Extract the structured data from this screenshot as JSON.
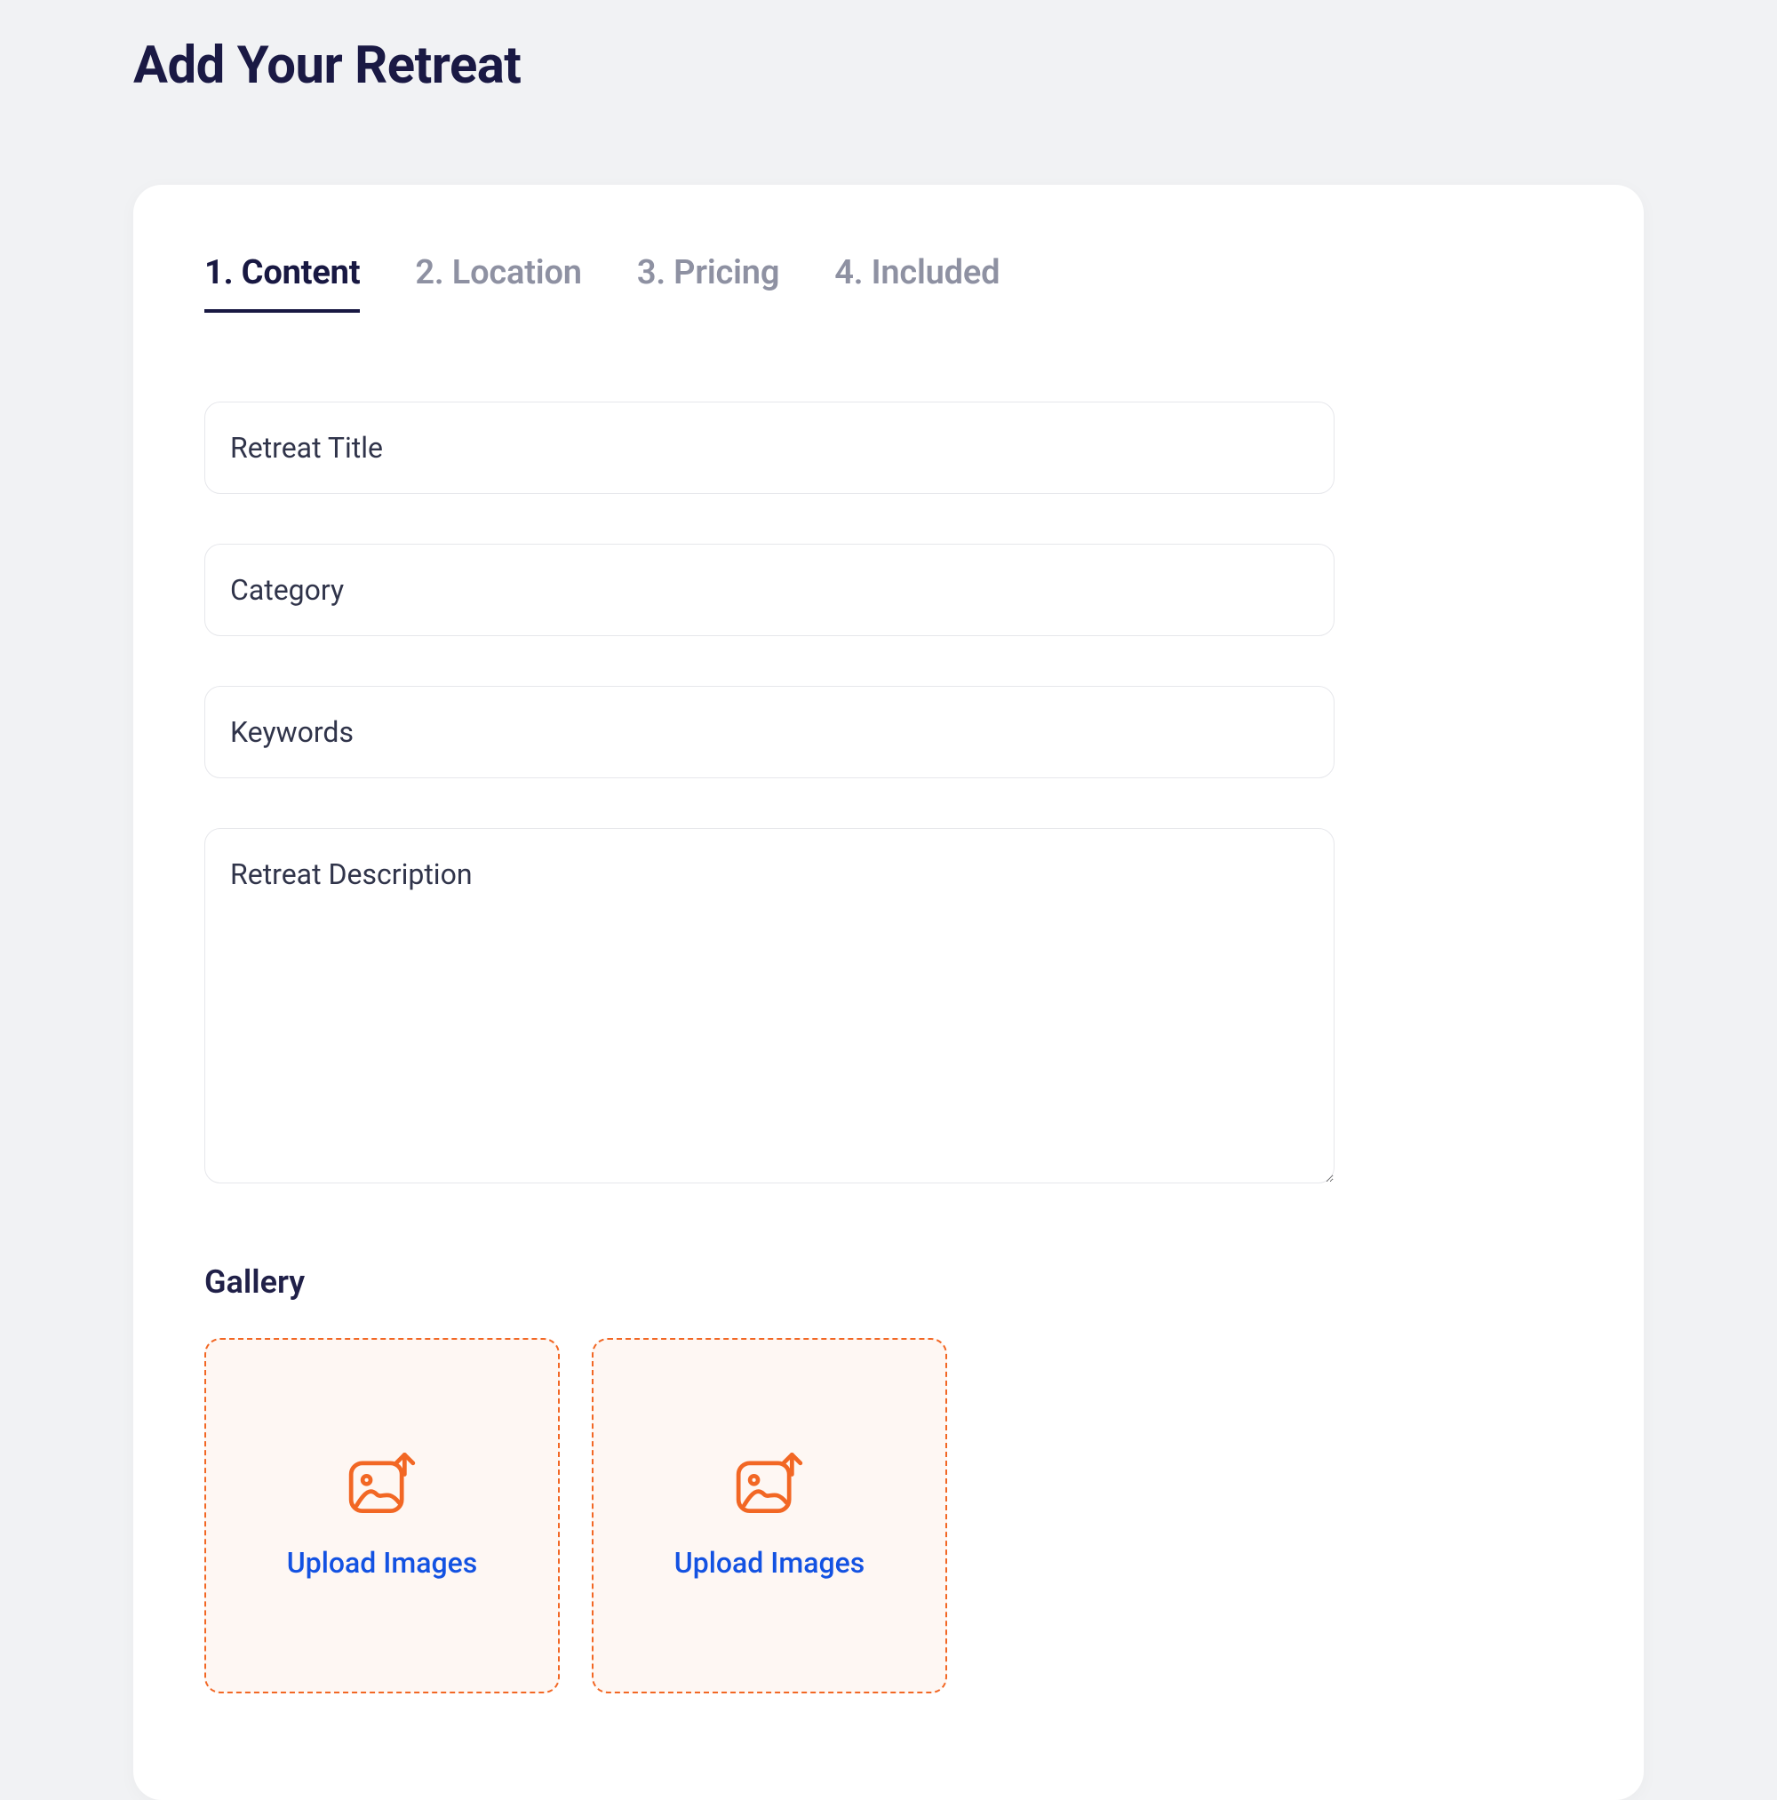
{
  "page": {
    "title": "Add Your Retreat"
  },
  "tabs": [
    {
      "label": "1. Content",
      "active": true
    },
    {
      "label": "2. Location",
      "active": false
    },
    {
      "label": "3. Pricing",
      "active": false
    },
    {
      "label": "4. Included",
      "active": false
    }
  ],
  "form": {
    "title": {
      "value": "",
      "placeholder": "Retreat Title"
    },
    "category": {
      "value": "",
      "placeholder": "Category"
    },
    "keywords": {
      "value": "",
      "placeholder": "Keywords"
    },
    "description": {
      "value": "",
      "placeholder": "Retreat Description"
    }
  },
  "gallery": {
    "heading": "Gallery",
    "tiles": [
      {
        "label": "Upload Images",
        "icon": "image-upload-icon"
      },
      {
        "label": "Upload Images",
        "icon": "image-upload-icon"
      }
    ]
  },
  "colors": {
    "accent": "#F26724",
    "link": "#1352E2",
    "heading": "#1A1944"
  }
}
